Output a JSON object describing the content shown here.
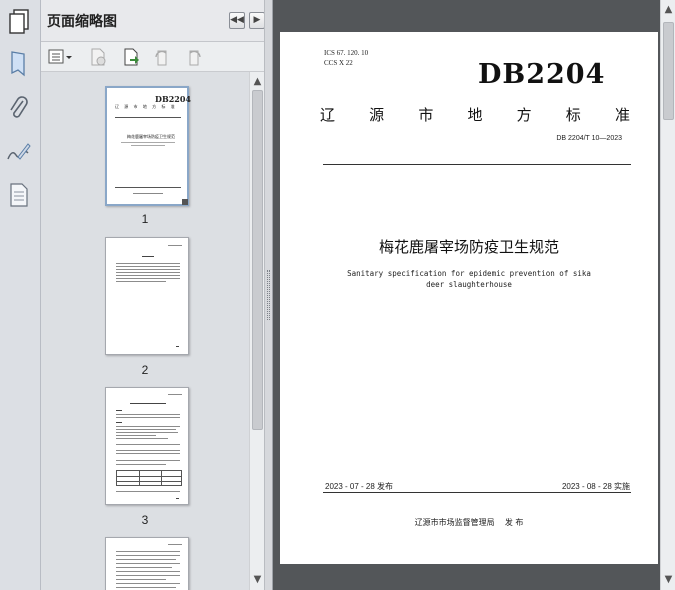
{
  "panel": {
    "title": "页面缩略图",
    "thumbnails": [
      {
        "label": "1"
      },
      {
        "label": "2"
      },
      {
        "label": "3"
      }
    ]
  },
  "document": {
    "ics": "ICS   67. 120. 10",
    "ccs": "CCS   X 22",
    "db_logo": "DB2204",
    "standard_type_chars": [
      "辽",
      "源",
      "市",
      "地",
      "方",
      "标",
      "准"
    ],
    "standard_number": "DB 2204/T 10—2023",
    "title_zh": "梅花鹿屠宰场防疫卫生规范",
    "title_en": "Sanitary specification for epidemic prevention of sika deer slaughterhouse",
    "issue_date": "2023 - 07 - 28 发布",
    "implement_date": "2023 - 08 - 28 实施",
    "issuer": "辽源市市场监督管理局",
    "issue_word": "发 布"
  },
  "thumb1": {
    "db": "DB2204",
    "row": "辽 源 市 地 方 标 准",
    "title": "梅花鹿屠宰场防疫卫生规范"
  },
  "colors": {
    "doc_background": "#535659",
    "panel_background": "#dcdfe3",
    "page": "#ffffff"
  },
  "icons": [
    "pages-icon",
    "bookmark-icon",
    "attachment-icon",
    "signature-icon",
    "document-icon",
    "first-page-icon",
    "next-page-icon",
    "thumbnail-options-icon",
    "delete-page-icon",
    "insert-page-icon",
    "rotate-left-icon",
    "rotate-right-icon"
  ]
}
